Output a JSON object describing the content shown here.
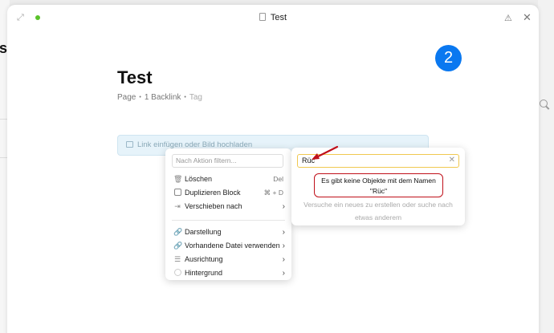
{
  "background": {
    "edge_text": "st"
  },
  "titlebar": {
    "title": "Test"
  },
  "badge": {
    "number": "2",
    "color": "#0a78f0"
  },
  "page": {
    "title": "Test",
    "type": "Page",
    "backlinks": "1 Backlink",
    "tag_placeholder": "Tag"
  },
  "link_box": {
    "placeholder": "Link einfügen oder Bild hochladen"
  },
  "action_menu": {
    "filter_placeholder": "Nach Aktion filtern...",
    "items": [
      {
        "label": "Löschen",
        "shortcut": "Del",
        "icon": "trash-icon"
      },
      {
        "label": "Duplizieren Block",
        "shortcut": "⌘ + D",
        "icon": "duplicate-icon"
      },
      {
        "label": "Verschieben nach",
        "icon": "move-icon"
      },
      {
        "label": "Darstellung",
        "icon": "link-icon"
      },
      {
        "label": "Vorhandene Datei verwenden",
        "icon": "link-icon"
      },
      {
        "label": "Ausrichtung",
        "icon": "align-icon"
      },
      {
        "label": "Hintergrund",
        "icon": "circle-icon"
      }
    ]
  },
  "search_popup": {
    "query": "Rüc",
    "not_found_line1": "Es gibt keine Objekte mit dem Namen",
    "not_found_line2": "\"Rüc\"",
    "hint": "Versuche ein neues zu erstellen oder suche nach etwas anderem"
  },
  "colors": {
    "accent": "#0a78f0",
    "highlight": "#c0101a",
    "focus": "#f0c850",
    "sync": "#5ac22a"
  }
}
